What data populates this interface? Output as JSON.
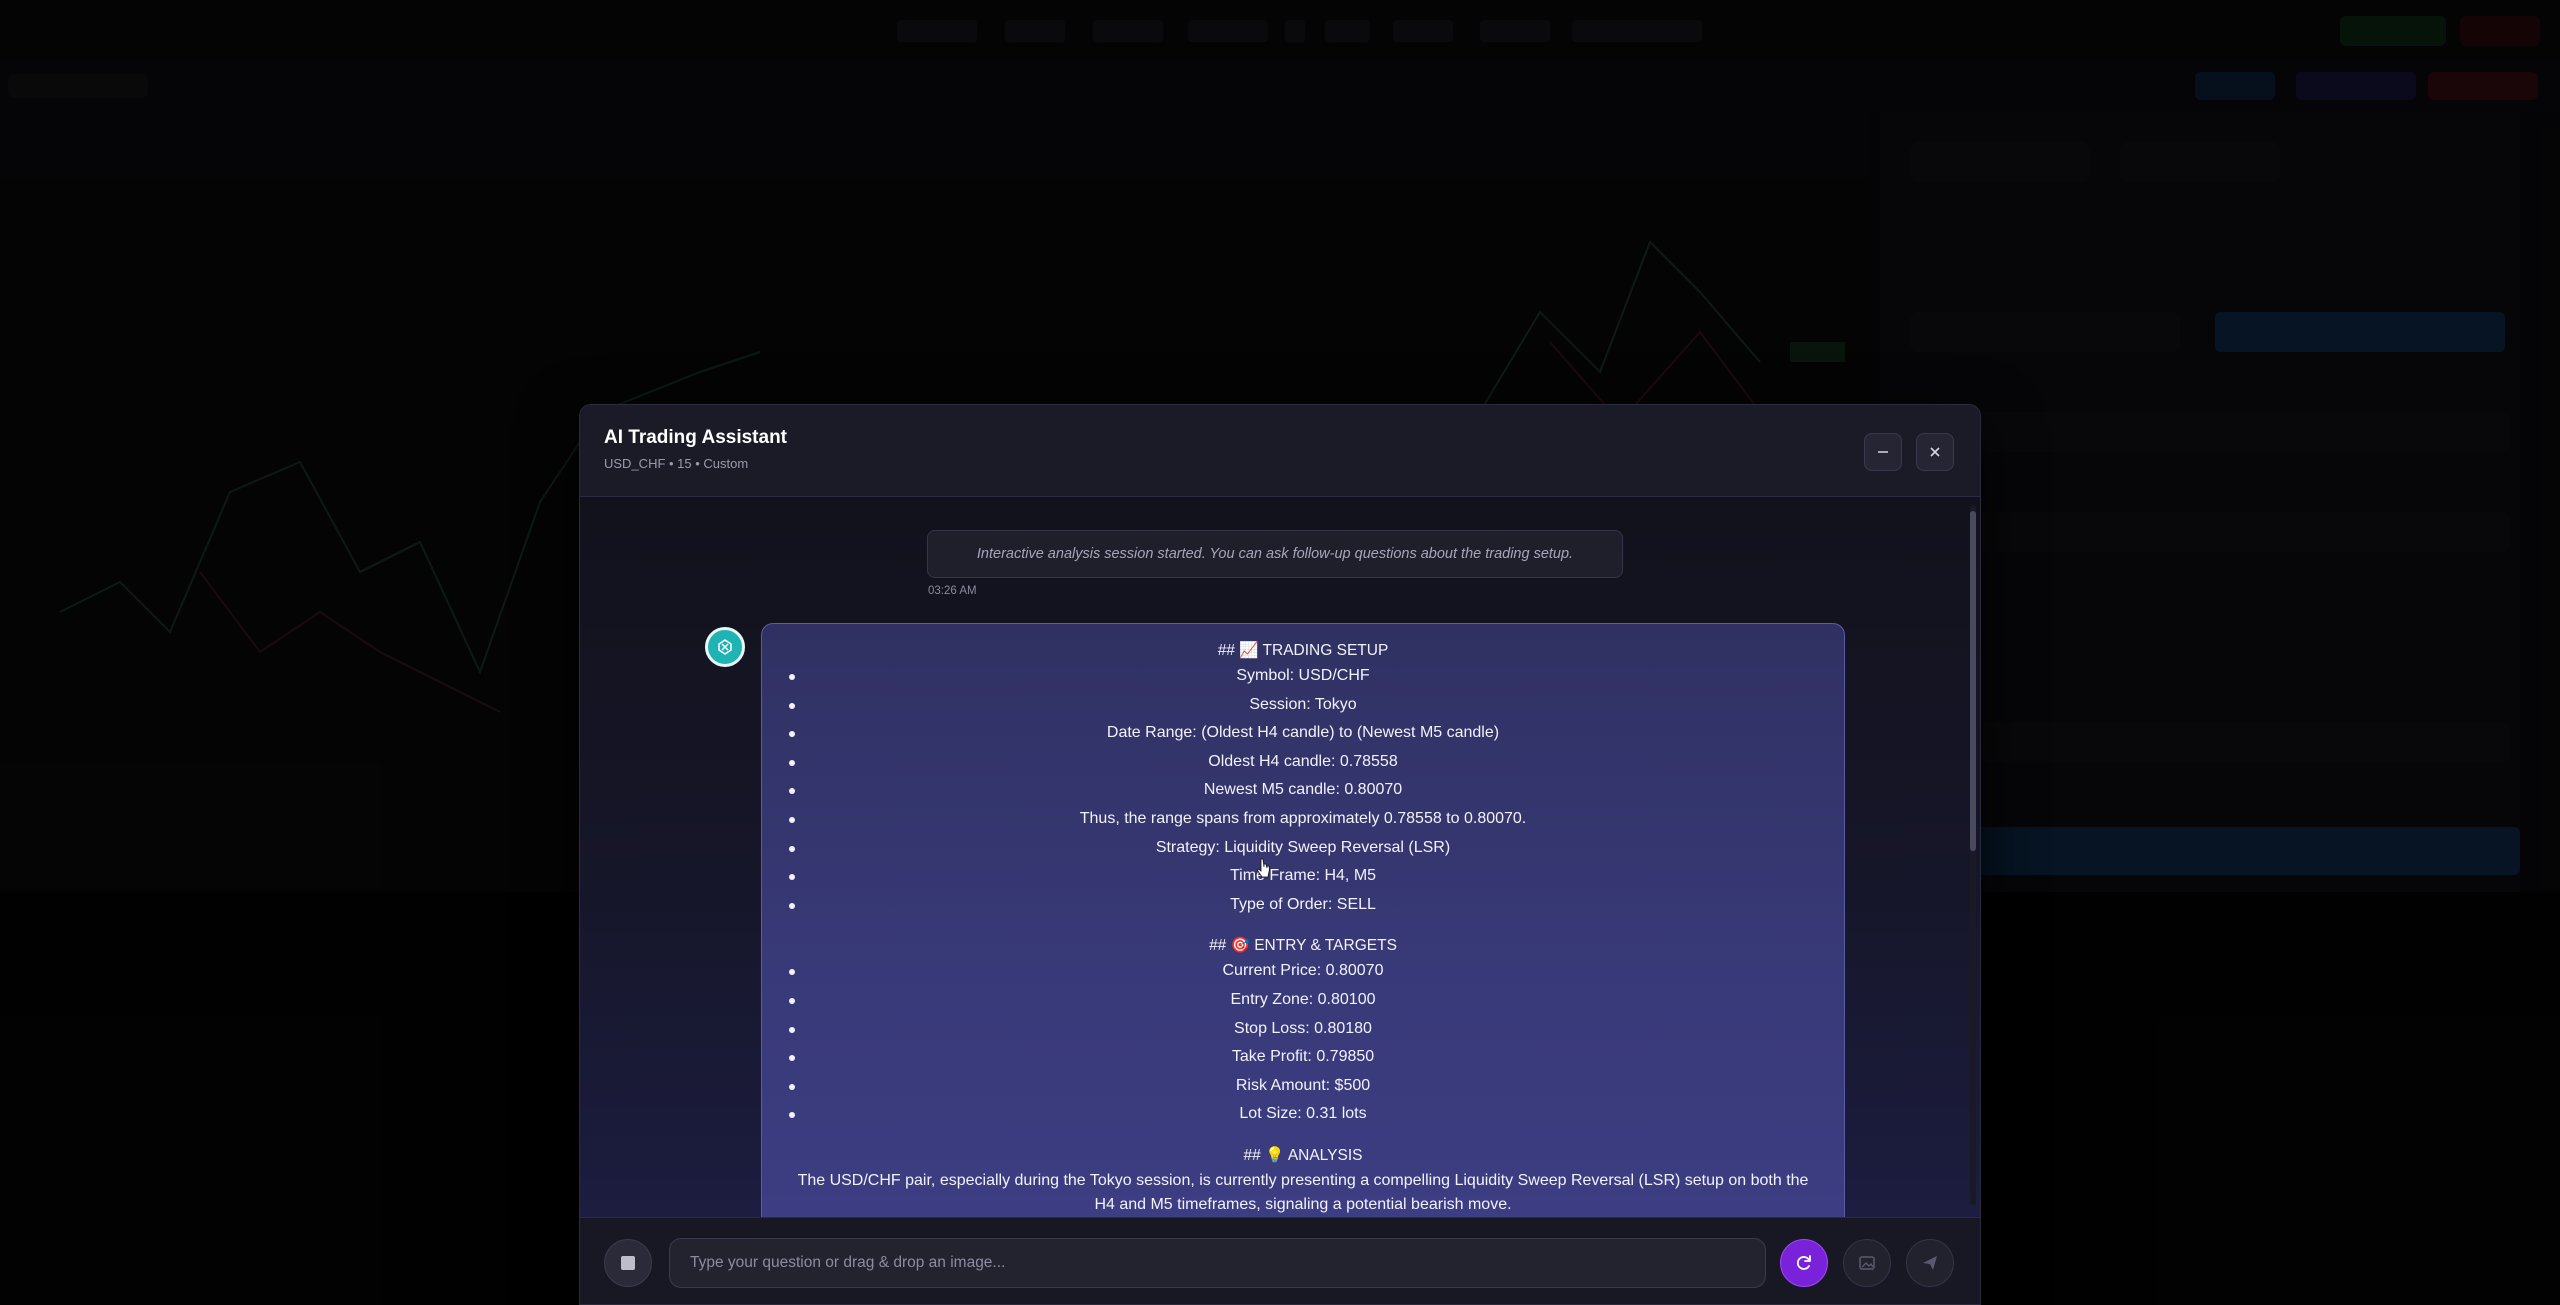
{
  "modal": {
    "title": "AI Trading Assistant",
    "subtitle": "USD_CHF • 15 • Custom",
    "minimize_icon": "minus-icon",
    "close_icon": "close-icon"
  },
  "system_message": {
    "text": "Interactive analysis session started. You can ask follow-up questions about the trading setup.",
    "time": "03:26 AM"
  },
  "ai_message": {
    "avatar_icon": "assistant-logo-icon",
    "sections": [
      {
        "heading": "## 📈 TRADING SETUP",
        "items": [
          "Symbol: USD/CHF",
          "Session: Tokyo",
          "Date Range: (Oldest H4 candle) to (Newest M5 candle)",
          "Oldest H4 candle: 0.78558",
          "Newest M5 candle: 0.80070",
          "Thus, the range spans from approximately 0.78558 to 0.80070.",
          "Strategy: Liquidity Sweep Reversal (LSR)",
          "Time Frame: H4, M5",
          "Type of Order: SELL"
        ]
      },
      {
        "heading": "## 🎯 ENTRY & TARGETS",
        "items": [
          "Current Price: 0.80070",
          "Entry Zone: 0.80100",
          "Stop Loss: 0.80180",
          "Take Profit: 0.79850",
          "Risk Amount: $500",
          "Lot Size: 0.31 lots"
        ]
      }
    ],
    "analysis_heading": "## 💡 ANALYSIS",
    "analysis_text": "The USD/CHF pair, especially during the Tokyo session, is currently presenting a compelling Liquidity Sweep Reversal (LSR) setup on both the H4 and M5 timeframes, signaling a potential bearish move."
  },
  "input": {
    "placeholder": "Type your question or drag & drop an image...",
    "value": "",
    "stop_icon": "stop-icon",
    "refresh_icon": "refresh-icon",
    "image_icon": "image-icon",
    "send_icon": "send-icon"
  },
  "colors": {
    "accent_purple": "#7a22d9",
    "bubble_bg": "#353670",
    "avatar_teal": "#1fb3b3"
  }
}
